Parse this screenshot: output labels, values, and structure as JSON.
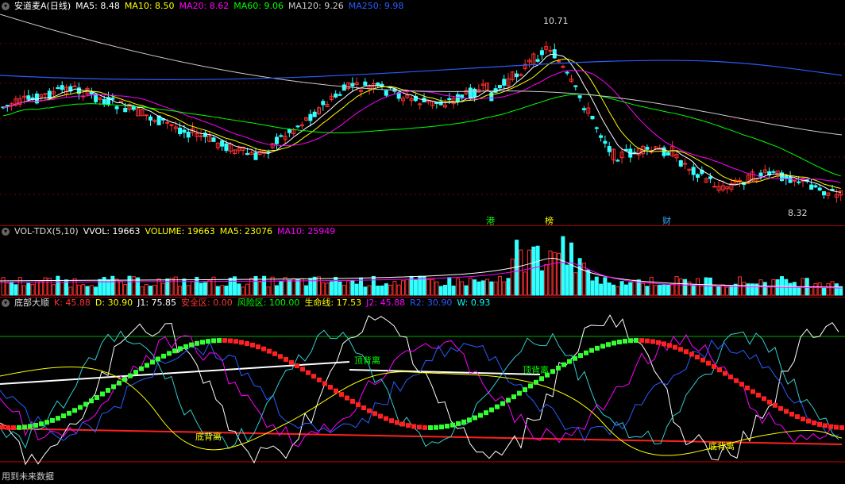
{
  "price": {
    "title": "安道麦A(日线)",
    "ma": [
      {
        "label": "MA5: 8.48",
        "color": "#ffffff"
      },
      {
        "label": "MA10: 8.50",
        "color": "#ffff00"
      },
      {
        "label": "MA20: 8.62",
        "color": "#ff00ff"
      },
      {
        "label": "MA60: 9.06",
        "color": "#00ff00"
      },
      {
        "label": "MA120: 9.26",
        "color": "#cccccc"
      },
      {
        "label": "MA250: 9.98",
        "color": "#2a5cff"
      }
    ],
    "high_label": "10.71",
    "low_label": "8.32",
    "markers": [
      {
        "text": "港",
        "color": "#ffff00"
      },
      {
        "text": "榜",
        "color": "#ffff00"
      },
      {
        "text": "财",
        "color": "#33aaff"
      }
    ]
  },
  "volume": {
    "title": "VOL-TDX(5,10)",
    "items": [
      {
        "label": "VVOL: 19663",
        "color": "#ffffff"
      },
      {
        "label": "VOLUME: 19663",
        "color": "#ffff00"
      },
      {
        "label": "MA5: 23076",
        "color": "#ffff00"
      },
      {
        "label": "MA10: 25949",
        "color": "#ff00ff"
      }
    ]
  },
  "indicator": {
    "title": "底部大顺",
    "items": [
      {
        "label": "K: 45.88",
        "color": "#ff3333"
      },
      {
        "label": "D: 30.90",
        "color": "#ffff00"
      },
      {
        "label": "J1: 75.85",
        "color": "#ffffff"
      },
      {
        "label": "安全区: 0.00",
        "color": "#ff3333"
      },
      {
        "label": "风险区: 100.00",
        "color": "#00ff00"
      },
      {
        "label": "生命线: 17.53",
        "color": "#ffff00"
      },
      {
        "label": "J2: 45.88",
        "color": "#ff00ff"
      },
      {
        "label": "R2: 30.90",
        "color": "#2a5cff"
      },
      {
        "label": "W: 0.93",
        "color": "#00ffff"
      }
    ],
    "annotations": [
      "顶背离",
      "顶背离",
      "底背离",
      "底背离"
    ]
  },
  "footer": "用到未来数据",
  "colors": {
    "up": "#ff3030",
    "down": "#33ffff",
    "grid": "#8b0000"
  }
}
